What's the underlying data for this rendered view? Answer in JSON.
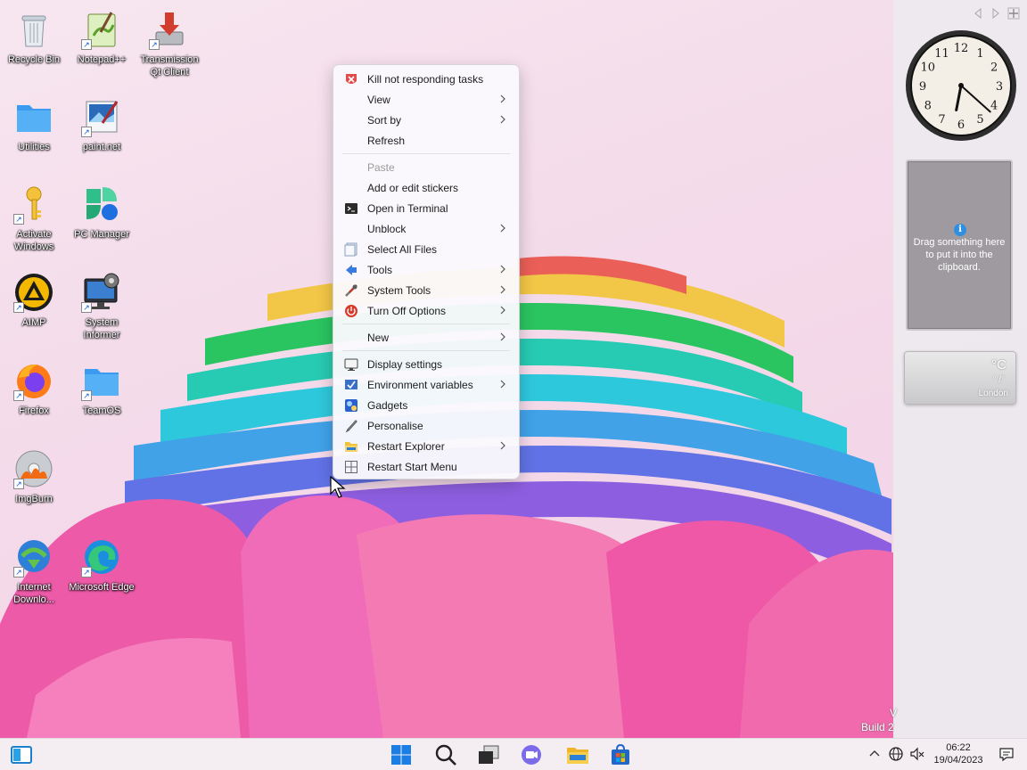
{
  "desktop": {
    "icons": [
      {
        "label": "Recycle Bin",
        "icon": "recycle-bin-icon"
      },
      {
        "label": "Notepad++",
        "icon": "notepadpp-icon"
      },
      {
        "label": "Transmission Qt Client",
        "icon": "transmission-icon"
      },
      {
        "label": "Utilities",
        "icon": "folder-icon"
      },
      {
        "label": "paint.net",
        "icon": "paintnet-icon"
      },
      {
        "label": "Activate Windows",
        "icon": "key-icon"
      },
      {
        "label": "PC Manager",
        "icon": "pc-manager-icon"
      },
      {
        "label": "AIMP",
        "icon": "aimp-icon"
      },
      {
        "label": "System Informer",
        "icon": "system-informer-icon"
      },
      {
        "label": "Firefox",
        "icon": "firefox-icon"
      },
      {
        "label": "TeamOS",
        "icon": "folder-icon"
      },
      {
        "label": "ImgBurn",
        "icon": "imgburn-icon"
      },
      {
        "label": "Internet Downlo...",
        "icon": "idm-icon"
      },
      {
        "label": "Microsoft Edge",
        "icon": "edge-icon"
      }
    ]
  },
  "context_menu": {
    "items": [
      {
        "label": "Kill not responding tasks",
        "icon": "kill-icon"
      },
      {
        "label": "View",
        "submenu": true
      },
      {
        "label": "Sort by",
        "submenu": true
      },
      {
        "label": "Refresh"
      },
      {
        "label": "Paste",
        "disabled": true
      },
      {
        "label": "Add or edit stickers"
      },
      {
        "label": "Open in Terminal",
        "icon": "terminal-icon"
      },
      {
        "label": "Unblock",
        "submenu": true
      },
      {
        "label": "Select All Files",
        "icon": "select-all-icon"
      },
      {
        "label": "Tools",
        "icon": "tools-icon",
        "submenu": true
      },
      {
        "label": "System Tools",
        "icon": "system-tools-icon",
        "submenu": true
      },
      {
        "label": "Turn Off Options",
        "icon": "power-icon",
        "submenu": true
      },
      {
        "label": "New",
        "submenu": true
      },
      {
        "label": "Display settings",
        "icon": "display-icon"
      },
      {
        "label": "Environment variables",
        "icon": "environment-icon",
        "submenu": true
      },
      {
        "label": "Gadgets",
        "icon": "gadgets-icon"
      },
      {
        "label": "Personalise",
        "icon": "personalise-icon"
      },
      {
        "label": "Restart Explorer",
        "icon": "explorer-icon",
        "submenu": true
      },
      {
        "label": "Restart Start Menu",
        "icon": "start-menu-icon"
      }
    ]
  },
  "sidebar": {
    "clock": {
      "hour": 6,
      "minute": 22
    },
    "clipboard_text": "Drag something here to put it into the clipboard.",
    "weather": {
      "unit": "°C",
      "minmax": "° /°",
      "city": "London"
    }
  },
  "watermark": {
    "line1": "V",
    "line2": "Build 2"
  },
  "taskbar": {
    "pinned": [
      "start-icon",
      "search-icon",
      "task-view-icon",
      "chat-icon",
      "file-explorer-icon",
      "store-icon"
    ],
    "time": "06:22",
    "date": "19/04/2023"
  },
  "colors": {
    "menu_bg": "#faf9fc",
    "taskbar_bg": "#f4eef3",
    "sidebar_bg": "#eceaee",
    "accent": "#0a64c8"
  }
}
